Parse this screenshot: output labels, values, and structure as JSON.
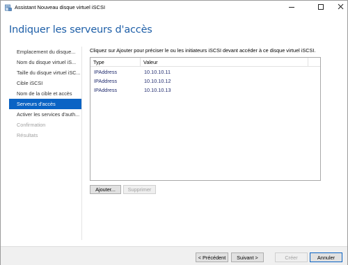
{
  "window": {
    "title": "Assistant Nouveau disque virtuel iSCSI",
    "icon": "server-disk-icon"
  },
  "header": {
    "title": "Indiquer les serveurs d'accès"
  },
  "nav": {
    "items": [
      {
        "label": "Emplacement du disque...",
        "state": "normal"
      },
      {
        "label": "Nom du disque virtuel iS...",
        "state": "normal"
      },
      {
        "label": "Taille du disque virtuel iSC...",
        "state": "normal"
      },
      {
        "label": "Cible iSCSI",
        "state": "normal"
      },
      {
        "label": "Nom de la cible et accès",
        "state": "normal"
      },
      {
        "label": "Serveurs d'accès",
        "state": "active"
      },
      {
        "label": "Activer les services d'auth...",
        "state": "normal"
      },
      {
        "label": "Confirmation",
        "state": "disabled"
      },
      {
        "label": "Résultats",
        "state": "disabled"
      }
    ],
    "active_color": "#0a63c4"
  },
  "main": {
    "description": "Cliquez sur Ajouter pour préciser le ou les initiateurs iSCSI devant accéder à ce disque virtuel iSCSI.",
    "table": {
      "columns": [
        "Type",
        "Valeur"
      ],
      "rows": [
        [
          "IPAddress",
          "10.10.10.11"
        ],
        [
          "IPAddress",
          "10.10.10.12"
        ],
        [
          "IPAddress",
          "10.10.10.13"
        ]
      ]
    },
    "add_button": "Ajouter...",
    "remove_button": "Supprimer"
  },
  "footer": {
    "previous": "< Précédent",
    "next": "Suivant >",
    "create": "Créer",
    "cancel": "Annuler"
  },
  "colors": {
    "title_blue": "#1e5fa8",
    "row_text": "#1f2a6e"
  }
}
